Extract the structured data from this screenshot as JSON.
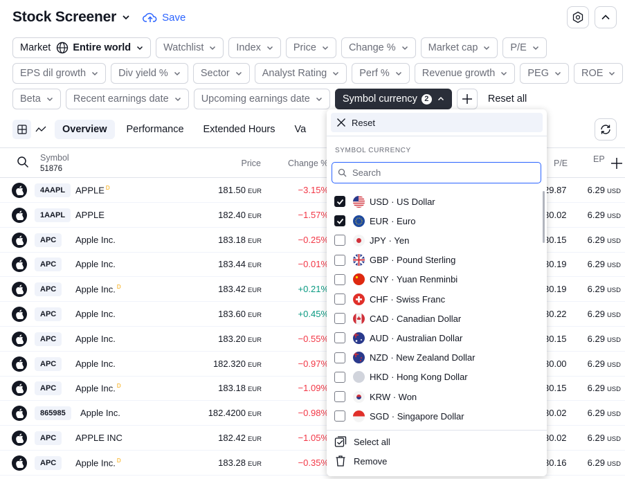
{
  "header": {
    "title": "Stock Screener",
    "save_label": "Save"
  },
  "filters": {
    "row1": [
      {
        "label": "Market",
        "value": "Entire world"
      },
      {
        "label": "Watchlist"
      },
      {
        "label": "Index"
      },
      {
        "label": "Price"
      },
      {
        "label": "Change %"
      },
      {
        "label": "Market cap"
      },
      {
        "label": "P/E"
      }
    ],
    "row2": [
      {
        "label": "EPS dil growth"
      },
      {
        "label": "Div yield %"
      },
      {
        "label": "Sector"
      },
      {
        "label": "Analyst Rating"
      },
      {
        "label": "Perf %"
      },
      {
        "label": "Revenue growth"
      },
      {
        "label": "PEG"
      },
      {
        "label": "ROE"
      }
    ],
    "row3": [
      {
        "label": "Beta"
      },
      {
        "label": "Recent earnings date"
      },
      {
        "label": "Upcoming earnings date"
      },
      {
        "label": "Symbol currency",
        "count": "2"
      }
    ],
    "reset_all": "Reset all"
  },
  "tabs": [
    "Overview",
    "Performance",
    "Extended Hours",
    "Va"
  ],
  "table": {
    "headers": {
      "symbol": "Symbol",
      "symbol_count": "51876",
      "price": "Price",
      "change": "Change %",
      "pe": "P/E",
      "eps": "EP"
    },
    "rows": [
      {
        "ticker": "4AAPL",
        "name": "APPLE",
        "d": "D",
        "price": "181.50",
        "cur": "EUR",
        "change": "−3.15%",
        "pe": "29.87",
        "eps": "6.29",
        "eps_cur": "USD",
        "dir": "neg"
      },
      {
        "ticker": "1AAPL",
        "name": "APPLE",
        "d": "",
        "price": "182.40",
        "cur": "EUR",
        "change": "−1.57%",
        "pe": "30.02",
        "eps": "6.29",
        "eps_cur": "USD",
        "dir": "neg"
      },
      {
        "ticker": "APC",
        "name": "Apple Inc.",
        "d": "",
        "price": "183.18",
        "cur": "EUR",
        "change": "−0.25%",
        "pe": "30.15",
        "eps": "6.29",
        "eps_cur": "USD",
        "dir": "neg"
      },
      {
        "ticker": "APC",
        "name": "Apple Inc.",
        "d": "",
        "price": "183.44",
        "cur": "EUR",
        "change": "−0.01%",
        "pe": "30.19",
        "eps": "6.29",
        "eps_cur": "USD",
        "dir": "neg"
      },
      {
        "ticker": "APC",
        "name": "Apple Inc.",
        "d": "D",
        "price": "183.42",
        "cur": "EUR",
        "change": "+0.21%",
        "pe": "30.19",
        "eps": "6.29",
        "eps_cur": "USD",
        "dir": "pos"
      },
      {
        "ticker": "APC",
        "name": "Apple Inc.",
        "d": "",
        "price": "183.60",
        "cur": "EUR",
        "change": "+0.45%",
        "pe": "30.22",
        "eps": "6.29",
        "eps_cur": "USD",
        "dir": "pos"
      },
      {
        "ticker": "APC",
        "name": "Apple Inc.",
        "d": "",
        "price": "183.20",
        "cur": "EUR",
        "change": "−0.55%",
        "pe": "30.15",
        "eps": "6.29",
        "eps_cur": "USD",
        "dir": "neg"
      },
      {
        "ticker": "APC",
        "name": "Apple Inc.",
        "d": "",
        "price": "182.320",
        "cur": "EUR",
        "change": "−0.97%",
        "pe": "30.00",
        "eps": "6.29",
        "eps_cur": "USD",
        "dir": "neg"
      },
      {
        "ticker": "APC",
        "name": "Apple Inc.",
        "d": "D",
        "price": "183.18",
        "cur": "EUR",
        "change": "−1.09%",
        "pe": "30.15",
        "eps": "6.29",
        "eps_cur": "USD",
        "dir": "neg"
      },
      {
        "ticker": "865985",
        "name": "Apple Inc.",
        "d": "",
        "price": "182.4200",
        "cur": "EUR",
        "change": "−0.98%",
        "pe": "30.02",
        "eps": "6.29",
        "eps_cur": "USD",
        "dir": "neg"
      },
      {
        "ticker": "APC",
        "name": "APPLE INC",
        "d": "",
        "price": "182.42",
        "cur": "EUR",
        "change": "−1.05%",
        "pe": "30.02",
        "eps": "6.29",
        "eps_cur": "USD",
        "dir": "neg"
      },
      {
        "ticker": "APC",
        "name": "Apple Inc.",
        "d": "D",
        "price": "183.28",
        "cur": "EUR",
        "change": "−0.35%",
        "pe": "30.16",
        "eps": "6.29",
        "eps_cur": "USD",
        "dir": "neg"
      }
    ]
  },
  "dropdown": {
    "reset_label": "Reset",
    "section_title": "SYMBOL CURRENCY",
    "search_placeholder": "Search",
    "options": [
      {
        "code": "USD",
        "name": "US Dollar",
        "checked": true,
        "flag": "us"
      },
      {
        "code": "EUR",
        "name": "Euro",
        "checked": true,
        "flag": "eu"
      },
      {
        "code": "JPY",
        "name": "Yen",
        "checked": false,
        "flag": "jp"
      },
      {
        "code": "GBP",
        "name": "Pound Sterling",
        "checked": false,
        "flag": "gb"
      },
      {
        "code": "CNY",
        "name": "Yuan Renminbi",
        "checked": false,
        "flag": "cn"
      },
      {
        "code": "CHF",
        "name": "Swiss Franc",
        "checked": false,
        "flag": "ch"
      },
      {
        "code": "CAD",
        "name": "Canadian Dollar",
        "checked": false,
        "flag": "ca"
      },
      {
        "code": "AUD",
        "name": "Australian Dollar",
        "checked": false,
        "flag": "au"
      },
      {
        "code": "NZD",
        "name": "New Zealand Dollar",
        "checked": false,
        "flag": "nz"
      },
      {
        "code": "HKD",
        "name": "Hong Kong Dollar",
        "checked": false,
        "flag": "hk"
      },
      {
        "code": "KRW",
        "name": "Won",
        "checked": false,
        "flag": "kr"
      },
      {
        "code": "SGD",
        "name": "Singapore Dollar",
        "checked": false,
        "flag": "sg"
      }
    ],
    "select_all_label": "Select all",
    "remove_label": "Remove"
  },
  "colors": {
    "accent": "#2962ff",
    "negative": "#f23645",
    "positive": "#089981",
    "active_chip": "#2a2e39"
  }
}
